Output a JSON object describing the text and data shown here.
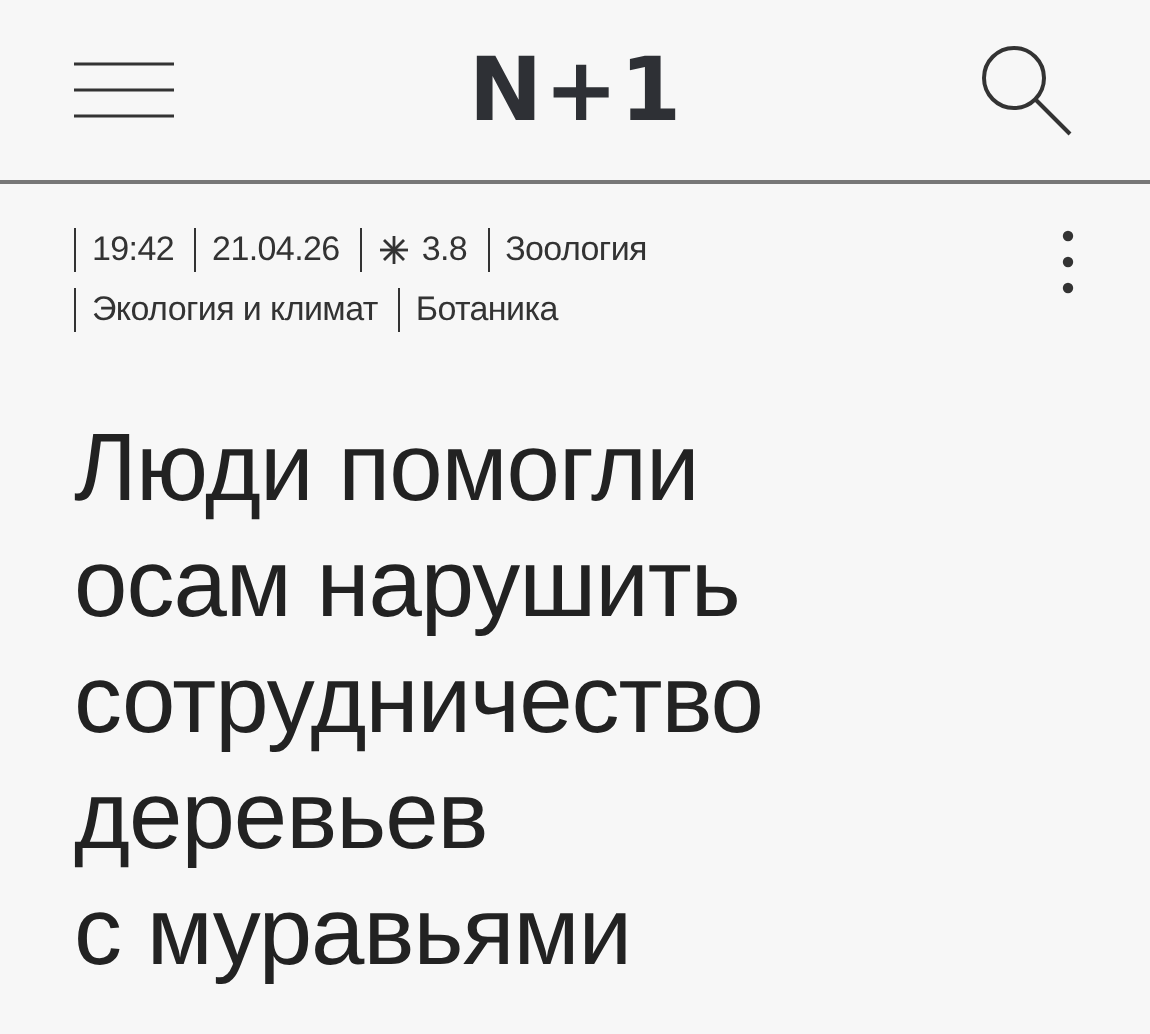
{
  "header": {
    "logo": "N+1"
  },
  "meta": {
    "items": [
      {
        "kind": "text",
        "text": "19:42"
      },
      {
        "kind": "text",
        "text": "21.04.26"
      },
      {
        "kind": "difficulty",
        "text": "3.8"
      },
      {
        "kind": "link",
        "text": "Зоология"
      },
      {
        "kind": "link",
        "text": "Экология и климат"
      },
      {
        "kind": "link",
        "text": "Ботаника"
      }
    ]
  },
  "article": {
    "title_lines": [
      "Люди помогли",
      "осам нарушить",
      "сотрудничество",
      "деревьев",
      "с муравьями"
    ]
  }
}
